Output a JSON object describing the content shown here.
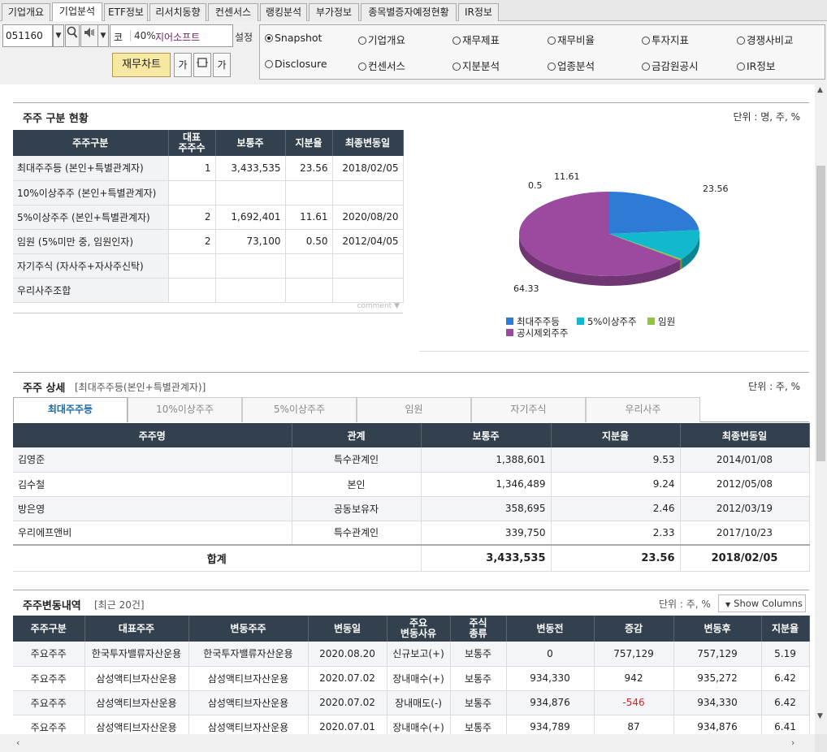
{
  "menu": {
    "tabs": [
      {
        "label": "기업개요"
      },
      {
        "label": "기업분석"
      },
      {
        "label": "ETF정보"
      },
      {
        "label": "리서치동향"
      },
      {
        "label": "컨센서스"
      },
      {
        "label": "랭킹분석"
      },
      {
        "label": "부가정보"
      },
      {
        "label": "종목별증자예정현황"
      },
      {
        "label": "IR정보"
      }
    ],
    "active": "기업분석"
  },
  "toolbar": {
    "code": "051160",
    "market": "코",
    "pct": "40%",
    "company": "지어소프트",
    "setting": "설정",
    "chart_button": "재무차트",
    "font_small": "가",
    "font_large": "가"
  },
  "radios": [
    {
      "label": "Snapshot",
      "selected": true
    },
    {
      "label": "기업개요",
      "selected": false
    },
    {
      "label": "재무제표",
      "selected": false
    },
    {
      "label": "재무비율",
      "selected": false
    },
    {
      "label": "투자지표",
      "selected": false
    },
    {
      "label": "경쟁사비교",
      "selected": false
    },
    {
      "label": "Disclosure",
      "selected": false
    },
    {
      "label": "컨센서스",
      "selected": false
    },
    {
      "label": "지분분석",
      "selected": false
    },
    {
      "label": "업종분석",
      "selected": false
    },
    {
      "label": "금감원공시",
      "selected": false
    },
    {
      "label": "IR정보",
      "selected": false
    }
  ],
  "section1": {
    "title": "주주 구분 현황",
    "unit": "단위 : 명, 주, %",
    "headers": [
      "주주구분",
      "대표\n주주수",
      "보통주",
      "지분율",
      "최종변동일"
    ],
    "rows": [
      {
        "label": "최대주주등 (본인+특별관계자)",
        "count": "1",
        "shares": "3,433,535",
        "ratio": "23.56",
        "date": "2018/02/05"
      },
      {
        "label": "10%이상주주 (본인+특별관계자)",
        "count": "",
        "shares": "",
        "ratio": "",
        "date": ""
      },
      {
        "label": "5%이상주주 (본인+특별관계자)",
        "count": "2",
        "shares": "1,692,401",
        "ratio": "11.61",
        "date": "2020/08/20"
      },
      {
        "label": "임원 (5%미만 중, 임원인자)",
        "count": "2",
        "shares": "73,100",
        "ratio": "0.50",
        "date": "2012/04/05"
      },
      {
        "label": "자기주식 (자사주+자사주신탁)",
        "count": "",
        "shares": "",
        "ratio": "",
        "date": ""
      },
      {
        "label": "우리사주조합",
        "count": "",
        "shares": "",
        "ratio": "",
        "date": ""
      }
    ],
    "comment": "comment"
  },
  "chart_data": {
    "type": "pie",
    "categories": [
      "최대주주등",
      "5%이상주주",
      "임원",
      "공시제외주주"
    ],
    "values": [
      23.56,
      11.61,
      0.5,
      64.33
    ],
    "value_labels": [
      "23.56",
      "11.61",
      "0.5",
      "64.33"
    ],
    "colors": [
      "#2e7bd6",
      "#12b8cc",
      "#8dc63f",
      "#9b4aa0"
    ],
    "legend_position": "bottom"
  },
  "section2": {
    "title": "주주 상세",
    "subtitle": "[최대주주등(본인+특별관계자)]",
    "unit": "단위 : 주, %",
    "tabs": [
      "최대주주등",
      "10%이상주주",
      "5%이상주주",
      "임원",
      "자기주식",
      "우리사주"
    ],
    "active_tab": "최대주주등",
    "headers": [
      "주주명",
      "관계",
      "보통주",
      "지분율",
      "최종변동일"
    ],
    "rows": [
      {
        "name": "김영준",
        "relation": "특수관계인",
        "shares": "1,388,601",
        "ratio": "9.53",
        "date": "2014/01/08"
      },
      {
        "name": "김수철",
        "relation": "본인",
        "shares": "1,346,489",
        "ratio": "9.24",
        "date": "2012/05/08"
      },
      {
        "name": "방은영",
        "relation": "공동보유자",
        "shares": "358,695",
        "ratio": "2.46",
        "date": "2012/03/19"
      },
      {
        "name": "우리에프앤비",
        "relation": "특수관계인",
        "shares": "339,750",
        "ratio": "2.33",
        "date": "2017/10/23"
      }
    ],
    "total": {
      "label": "합계",
      "shares": "3,433,535",
      "ratio": "23.56",
      "date": "2018/02/05"
    }
  },
  "section3": {
    "title": "주주변동내역",
    "subtitle": "[최근 20건]",
    "unit": "단위 : 주, %",
    "show_columns": "Show Columns",
    "headers": [
      "주주구분",
      "대표주주",
      "변동주주",
      "변동일",
      "주요\n변동사유",
      "주식\n종류",
      "변동전",
      "증감",
      "변동후",
      "지분율"
    ],
    "rows": [
      {
        "type": "주요주주",
        "rep": "한국투자밸류자산운용",
        "holder": "한국투자밸류자산운용",
        "date": "2020.08.20",
        "reason": "신규보고(+)",
        "kind": "보통주",
        "before": "0",
        "change": "757,129",
        "after": "757,129",
        "ratio": "5.19"
      },
      {
        "type": "주요주주",
        "rep": "삼성액티브자산운용",
        "holder": "삼성액티브자산운용",
        "date": "2020.07.02",
        "reason": "장내매수(+)",
        "kind": "보통주",
        "before": "934,330",
        "change": "942",
        "after": "935,272",
        "ratio": "6.42"
      },
      {
        "type": "주요주주",
        "rep": "삼성액티브자산운용",
        "holder": "삼성액티브자산운용",
        "date": "2020.07.02",
        "reason": "장내매도(-)",
        "kind": "보통주",
        "before": "934,876",
        "change": "-546",
        "after": "934,330",
        "ratio": "6.42"
      },
      {
        "type": "주요주주",
        "rep": "삼성액티브자산운용",
        "holder": "삼성액티브자산운용",
        "date": "2020.07.01",
        "reason": "장내매수(+)",
        "kind": "보통주",
        "before": "934,789",
        "change": "87",
        "after": "934,876",
        "ratio": "6.41"
      }
    ]
  },
  "colors": {
    "header_bg": "#33414f",
    "negative": "#e02020",
    "accent_tab": "#1b6aa5"
  }
}
